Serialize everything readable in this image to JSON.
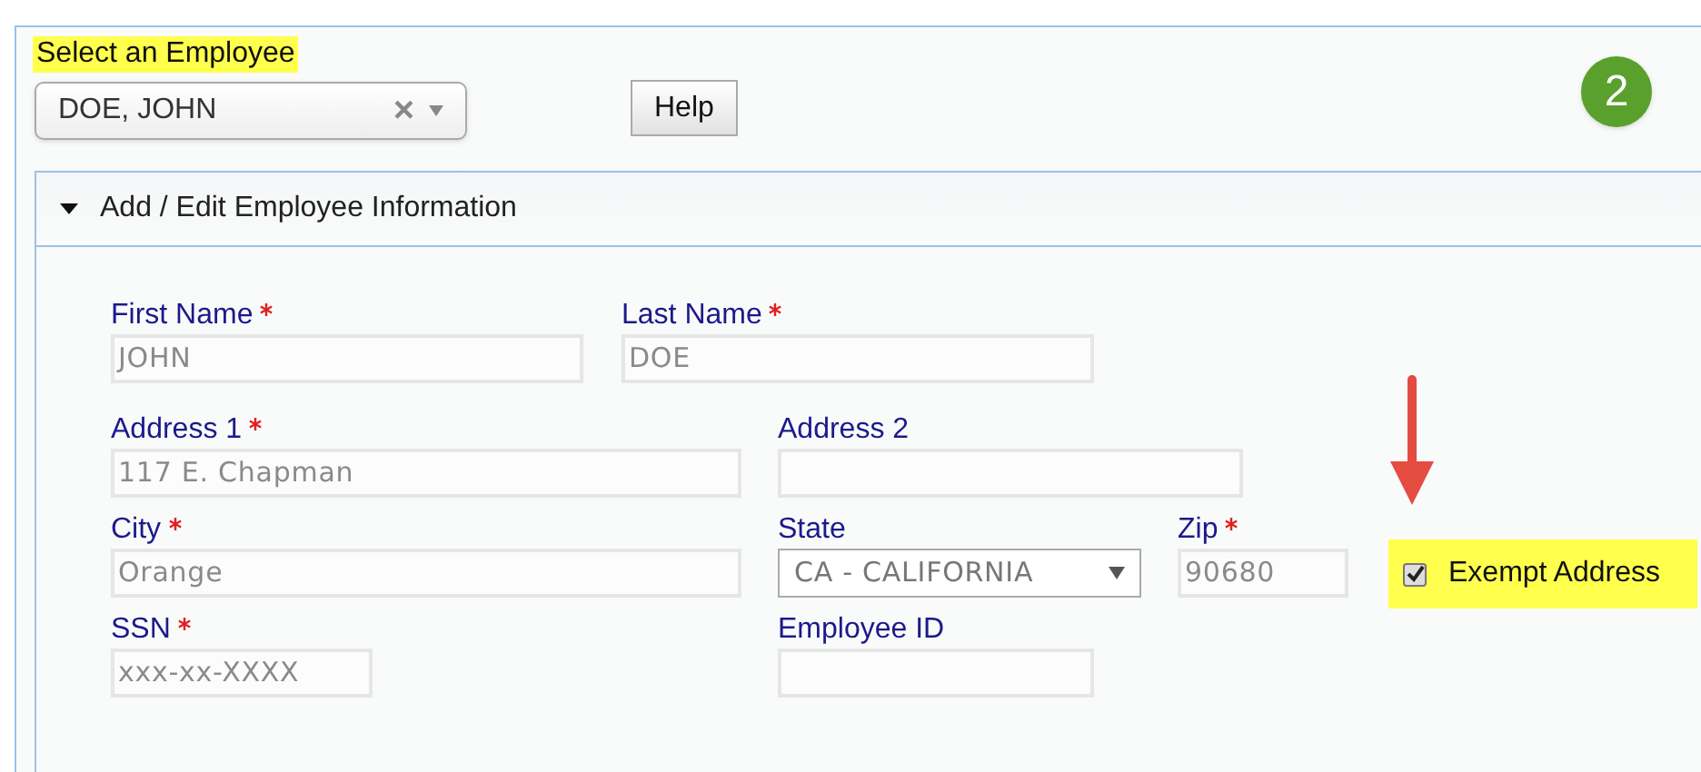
{
  "employee_select": {
    "label": "Select an Employee",
    "value": "DOE, JOHN",
    "clear": "×"
  },
  "help_button": "Help",
  "step_badge": "2",
  "section": {
    "title": "Add / Edit Employee Information",
    "expanded": true
  },
  "rows": [
    [
      {
        "kind": "text",
        "label": "First Name",
        "required": true,
        "value": "JOHN"
      },
      {
        "kind": "text",
        "label": "Last Name",
        "required": true,
        "value": "DOE"
      }
    ],
    [
      {
        "kind": "text",
        "label": "Address 1",
        "required": true,
        "value": "117 E. Chapman"
      },
      {
        "kind": "text",
        "label": "Address 2",
        "required": false
      }
    ],
    [
      {
        "kind": "text",
        "label": "City",
        "required": true,
        "value": "Orange"
      },
      {
        "kind": "select",
        "label": "State",
        "required": false,
        "value": "CA - CALIFORNIA"
      },
      {
        "kind": "text",
        "label": "Zip",
        "required": true,
        "value": "90680"
      },
      {
        "kind": "checkbox",
        "label": "Exempt Address",
        "checked": true
      }
    ],
    [
      {
        "kind": "text",
        "label": "SSN",
        "required": true,
        "placeholder": "xxx-xx-XXXX"
      },
      {
        "kind": "text",
        "label": "Employee ID",
        "required": false
      }
    ]
  ]
}
